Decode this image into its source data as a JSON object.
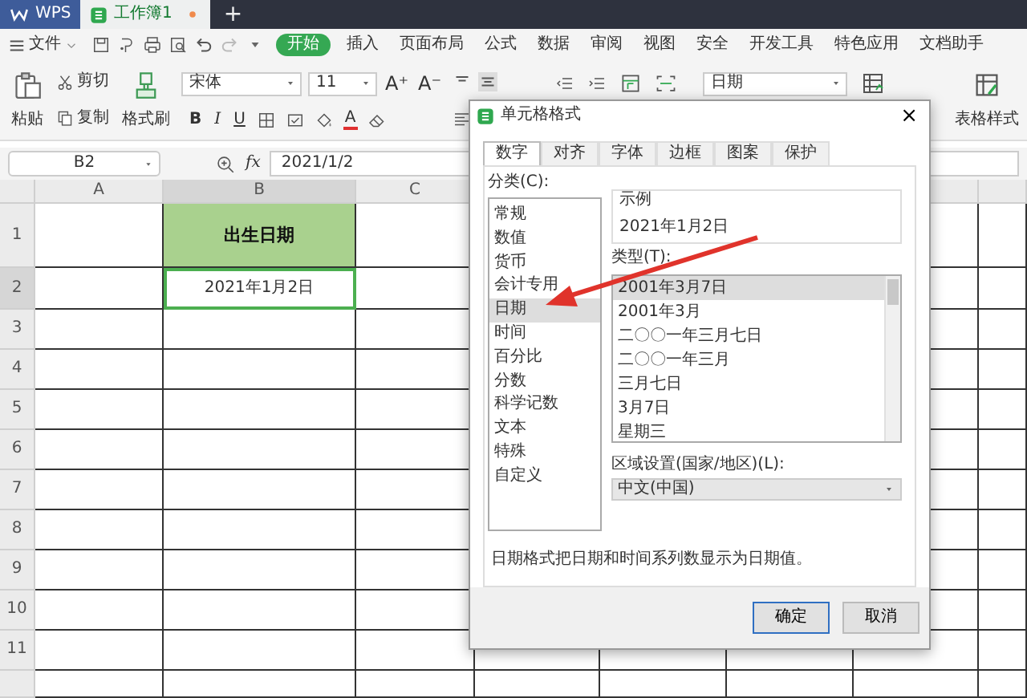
{
  "app_tabs": [
    {
      "kind": "brand",
      "label": "WPS",
      "selected": false
    },
    {
      "kind": "document",
      "label": "工作簿1",
      "selected": true,
      "unsaved": true
    },
    {
      "kind": "new",
      "label": "+",
      "selected": false
    }
  ],
  "menu": {
    "file": "文件",
    "items": [
      {
        "label": "开始",
        "selected": true
      },
      {
        "label": "插入",
        "selected": false
      },
      {
        "label": "页面布局",
        "selected": false
      },
      {
        "label": "公式",
        "selected": false
      },
      {
        "label": "数据",
        "selected": false
      },
      {
        "label": "审阅",
        "selected": false
      },
      {
        "label": "视图",
        "selected": false
      },
      {
        "label": "安全",
        "selected": false
      },
      {
        "label": "开发工具",
        "selected": false
      },
      {
        "label": "特色应用",
        "selected": false
      },
      {
        "label": "文档助手",
        "selected": false
      }
    ]
  },
  "ribbon": {
    "paste": "粘贴",
    "cut": "剪切",
    "copy": "复制",
    "format_painter": "格式刷",
    "font_name": "宋体",
    "font_size": "11",
    "font_grow": "A⁺",
    "font_shrink": "A⁻",
    "bold": "B",
    "italic": "I",
    "underline": "U",
    "font_color": "A",
    "number_format": "日期",
    "table_style": "表格样式"
  },
  "formula_bar": {
    "cell": "B2",
    "fx": "fx",
    "value": "2021/1/2"
  },
  "sheet": {
    "columns": [
      {
        "label": "A",
        "selected": false
      },
      {
        "label": "B",
        "selected": true
      },
      {
        "label": "C",
        "selected": false
      }
    ],
    "rows": [
      {
        "label": "1",
        "selected": false,
        "column_b": {
          "kind": "header",
          "text": "出生日期",
          "selected": false
        }
      },
      {
        "label": "2",
        "selected": true,
        "column_b": {
          "kind": "value",
          "text": "2021年1月2日",
          "selected": true
        }
      },
      {
        "label": "3",
        "selected": false
      },
      {
        "label": "4",
        "selected": false
      },
      {
        "label": "5",
        "selected": false
      },
      {
        "label": "6",
        "selected": false
      },
      {
        "label": "7",
        "selected": false
      },
      {
        "label": "8",
        "selected": false
      },
      {
        "label": "9",
        "selected": false
      },
      {
        "label": "10",
        "selected": false
      },
      {
        "label": "11",
        "selected": false
      }
    ]
  },
  "dialog": {
    "title": "单元格格式",
    "close": "×",
    "tabs": [
      {
        "label": "数字",
        "selected": true
      },
      {
        "label": "对齐",
        "selected": false
      },
      {
        "label": "字体",
        "selected": false
      },
      {
        "label": "边框",
        "selected": false
      },
      {
        "label": "图案",
        "selected": false
      },
      {
        "label": "保护",
        "selected": false
      }
    ],
    "category_label": "分类(C):",
    "categories": [
      {
        "label": "常规",
        "selected": false
      },
      {
        "label": "数值",
        "selected": false
      },
      {
        "label": "货币",
        "selected": false
      },
      {
        "label": "会计专用",
        "selected": false
      },
      {
        "label": "日期",
        "selected": true
      },
      {
        "label": "时间",
        "selected": false
      },
      {
        "label": "百分比",
        "selected": false
      },
      {
        "label": "分数",
        "selected": false
      },
      {
        "label": "科学记数",
        "selected": false
      },
      {
        "label": "文本",
        "selected": false
      },
      {
        "label": "特殊",
        "selected": false
      },
      {
        "label": "自定义",
        "selected": false
      }
    ],
    "sample": {
      "title": "示例",
      "value": "2021年1月2日"
    },
    "type_label": "类型(T):",
    "types": [
      {
        "label": "2001年3月7日",
        "selected": true
      },
      {
        "label": "2001年3月",
        "selected": false
      },
      {
        "label": "二〇〇一年三月七日",
        "selected": false
      },
      {
        "label": "二〇〇一年三月",
        "selected": false
      },
      {
        "label": "三月七日",
        "selected": false
      },
      {
        "label": "3月7日",
        "selected": false
      },
      {
        "label": "星期三",
        "selected": false
      }
    ],
    "locale_label": "区域设置(国家/地区)(L):",
    "locale": "中文(中国)",
    "description": "日期格式把日期和时间系列数显示为日期值。",
    "buttons": [
      {
        "label": "确定",
        "kind": "primary"
      },
      {
        "label": "取消",
        "kind": "secondary"
      }
    ]
  }
}
